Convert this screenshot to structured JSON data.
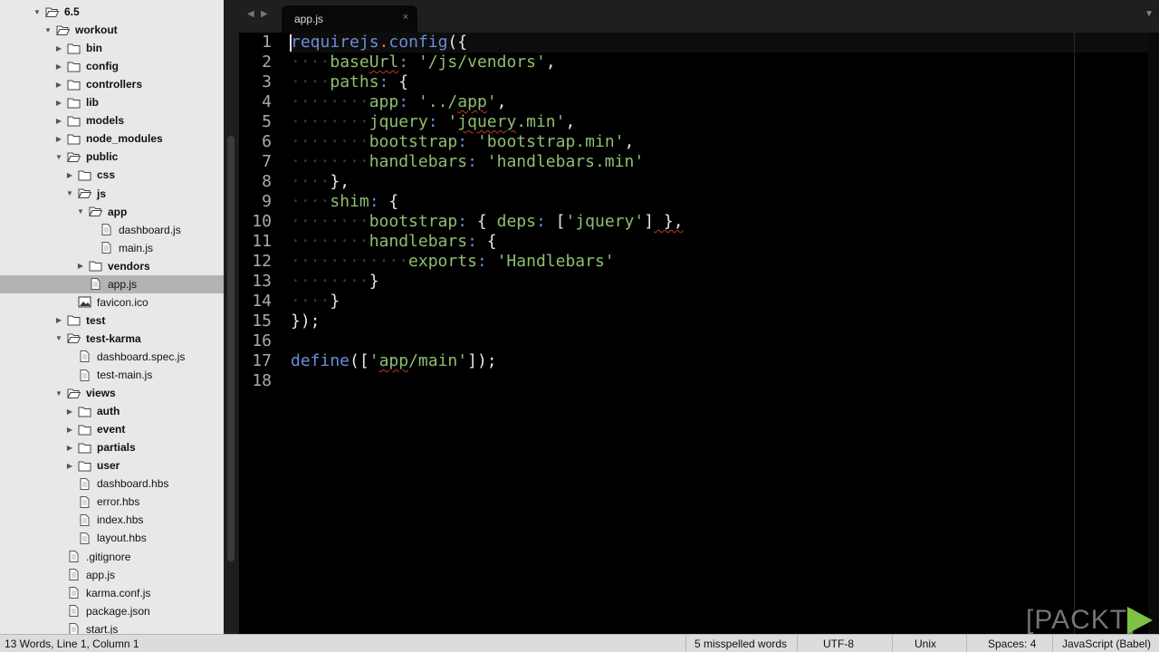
{
  "sidebar": {
    "items": [
      {
        "label": "6.5",
        "type": "folder",
        "state": "open",
        "depth": 0
      },
      {
        "label": "workout",
        "type": "folder",
        "state": "open",
        "depth": 1
      },
      {
        "label": "bin",
        "type": "folder",
        "state": "closed",
        "depth": 2
      },
      {
        "label": "config",
        "type": "folder",
        "state": "closed",
        "depth": 2
      },
      {
        "label": "controllers",
        "type": "folder",
        "state": "closed",
        "depth": 2
      },
      {
        "label": "lib",
        "type": "folder",
        "state": "closed",
        "depth": 2
      },
      {
        "label": "models",
        "type": "folder",
        "state": "closed",
        "depth": 2
      },
      {
        "label": "node_modules",
        "type": "folder",
        "state": "closed",
        "depth": 2
      },
      {
        "label": "public",
        "type": "folder",
        "state": "open",
        "depth": 2
      },
      {
        "label": "css",
        "type": "folder",
        "state": "closed",
        "depth": 3
      },
      {
        "label": "js",
        "type": "folder",
        "state": "open",
        "depth": 3
      },
      {
        "label": "app",
        "type": "folder",
        "state": "open",
        "depth": 4
      },
      {
        "label": "dashboard.js",
        "type": "file",
        "depth": 5
      },
      {
        "label": "main.js",
        "type": "file",
        "depth": 5
      },
      {
        "label": "vendors",
        "type": "folder",
        "state": "closed",
        "depth": 4
      },
      {
        "label": "app.js",
        "type": "file",
        "depth": 4,
        "selected": true
      },
      {
        "label": "favicon.ico",
        "type": "image",
        "depth": 3
      },
      {
        "label": "test",
        "type": "folder",
        "state": "closed",
        "depth": 2
      },
      {
        "label": "test-karma",
        "type": "folder",
        "state": "open",
        "depth": 2
      },
      {
        "label": "dashboard.spec.js",
        "type": "file",
        "depth": 3
      },
      {
        "label": "test-main.js",
        "type": "file",
        "depth": 3
      },
      {
        "label": "views",
        "type": "folder",
        "state": "open",
        "depth": 2
      },
      {
        "label": "auth",
        "type": "folder",
        "state": "closed",
        "depth": 3
      },
      {
        "label": "event",
        "type": "folder",
        "state": "closed",
        "depth": 3
      },
      {
        "label": "partials",
        "type": "folder",
        "state": "closed",
        "depth": 3
      },
      {
        "label": "user",
        "type": "folder",
        "state": "closed",
        "depth": 3
      },
      {
        "label": "dashboard.hbs",
        "type": "file",
        "depth": 3
      },
      {
        "label": "error.hbs",
        "type": "file",
        "depth": 3
      },
      {
        "label": "index.hbs",
        "type": "file",
        "depth": 3
      },
      {
        "label": "layout.hbs",
        "type": "file",
        "depth": 3
      },
      {
        "label": ".gitignore",
        "type": "file",
        "depth": 2
      },
      {
        "label": "app.js",
        "type": "file",
        "depth": 2
      },
      {
        "label": "karma.conf.js",
        "type": "file",
        "depth": 2
      },
      {
        "label": "package.json",
        "type": "file",
        "depth": 2
      },
      {
        "label": "start.js",
        "type": "file",
        "depth": 2
      }
    ]
  },
  "tabbar": {
    "back_icon": "◀",
    "forward_icon": "▶",
    "active_tab": "app.js",
    "close_icon": "×",
    "dropdown_icon": "▼"
  },
  "editor": {
    "lines": [
      [
        {
          "t": "requirejs",
          "c": "fn"
        },
        {
          "t": ".",
          "c": "dot"
        },
        {
          "t": "config",
          "c": "fn"
        },
        {
          "t": "({",
          "c": "p"
        }
      ],
      [
        {
          "t": "····",
          "c": "ind"
        },
        {
          "t": "baseUrl",
          "c": "key"
        },
        {
          "t": ":",
          "c": "colon"
        },
        {
          "t": " ",
          "c": "p"
        },
        {
          "t": "'/js/vendors'",
          "c": "str"
        },
        {
          "t": ",",
          "c": "p"
        }
      ],
      [
        {
          "t": "····",
          "c": "ind"
        },
        {
          "t": "paths",
          "c": "key"
        },
        {
          "t": ":",
          "c": "colon"
        },
        {
          "t": " {",
          "c": "p"
        }
      ],
      [
        {
          "t": "········",
          "c": "ind"
        },
        {
          "t": "app",
          "c": "key"
        },
        {
          "t": ":",
          "c": "colon"
        },
        {
          "t": " ",
          "c": "p"
        },
        {
          "t": "'../app'",
          "c": "str"
        },
        {
          "t": ",",
          "c": "p"
        }
      ],
      [
        {
          "t": "········",
          "c": "ind"
        },
        {
          "t": "jquery",
          "c": "key"
        },
        {
          "t": ":",
          "c": "colon"
        },
        {
          "t": " ",
          "c": "p"
        },
        {
          "t": "'jquery.min'",
          "c": "str"
        },
        {
          "t": ",",
          "c": "p"
        }
      ],
      [
        {
          "t": "········",
          "c": "ind"
        },
        {
          "t": "bootstrap",
          "c": "key"
        },
        {
          "t": ":",
          "c": "colon"
        },
        {
          "t": " ",
          "c": "p"
        },
        {
          "t": "'bootstrap.min'",
          "c": "str"
        },
        {
          "t": ",",
          "c": "p"
        }
      ],
      [
        {
          "t": "········",
          "c": "ind"
        },
        {
          "t": "handlebars",
          "c": "key"
        },
        {
          "t": ":",
          "c": "colon"
        },
        {
          "t": " ",
          "c": "p"
        },
        {
          "t": "'handlebars.min'",
          "c": "str"
        }
      ],
      [
        {
          "t": "····",
          "c": "ind"
        },
        {
          "t": "},",
          "c": "p"
        }
      ],
      [
        {
          "t": "····",
          "c": "ind"
        },
        {
          "t": "shim",
          "c": "key"
        },
        {
          "t": ":",
          "c": "colon"
        },
        {
          "t": " {",
          "c": "p"
        }
      ],
      [
        {
          "t": "········",
          "c": "ind"
        },
        {
          "t": "bootstrap",
          "c": "key"
        },
        {
          "t": ":",
          "c": "colon"
        },
        {
          "t": " { ",
          "c": "p"
        },
        {
          "t": "deps",
          "c": "key"
        },
        {
          "t": ":",
          "c": "colon"
        },
        {
          "t": " [",
          "c": "p"
        },
        {
          "t": "'jquery'",
          "c": "str"
        },
        {
          "t": "] },",
          "c": "p"
        }
      ],
      [
        {
          "t": "········",
          "c": "ind"
        },
        {
          "t": "handlebars",
          "c": "key"
        },
        {
          "t": ":",
          "c": "colon"
        },
        {
          "t": " {",
          "c": "p"
        }
      ],
      [
        {
          "t": "············",
          "c": "ind"
        },
        {
          "t": "exports",
          "c": "key"
        },
        {
          "t": ":",
          "c": "colon"
        },
        {
          "t": " ",
          "c": "p"
        },
        {
          "t": "'Handlebars'",
          "c": "str"
        }
      ],
      [
        {
          "t": "········",
          "c": "ind"
        },
        {
          "t": "}",
          "c": "p"
        }
      ],
      [
        {
          "t": "····",
          "c": "ind"
        },
        {
          "t": "}",
          "c": "p"
        }
      ],
      [
        {
          "t": "});",
          "c": "p"
        }
      ],
      [],
      [
        {
          "t": "define",
          "c": "fn"
        },
        {
          "t": "([",
          "c": "p"
        },
        {
          "t": "'app/main'",
          "c": "str"
        },
        {
          "t": "]);",
          "c": "p"
        }
      ],
      []
    ]
  },
  "statusbar": {
    "position": "13 Words, Line 1, Column 1",
    "spelling": "5 misspelled words",
    "encoding": "UTF-8",
    "line_endings": "Unix",
    "indentation": "Spaces: 4",
    "syntax": "JavaScript (Babel)"
  },
  "watermark": {
    "text": "[PACKT]",
    "accent": "#7dc242"
  },
  "colors": {
    "sidebar_bg": "#e8e8e8",
    "editor_bg": "#000000",
    "function": "#6a8fd8",
    "string": "#8fbf6f",
    "accessor_dot": "#e07a3a"
  }
}
